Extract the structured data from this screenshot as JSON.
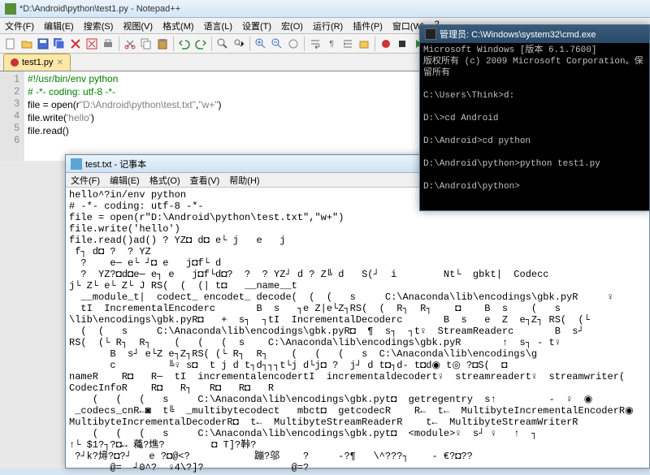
{
  "npp": {
    "title": "*D:\\Android\\python\\test1.py - Notepad++",
    "menu": [
      "文件(F)",
      "编辑(E)",
      "搜索(S)",
      "视图(V)",
      "格式(M)",
      "语言(L)",
      "设置(T)",
      "宏(O)",
      "运行(R)",
      "插件(P)",
      "窗口(W)",
      "?"
    ],
    "tab": "test1.py",
    "lines": [
      "1",
      "2",
      "3",
      "4",
      "5",
      "6"
    ],
    "code": {
      "l1": "#!/usr/bin/env python",
      "l2": "# -*- coding: utf-8 -*-",
      "l3a": "file = ",
      "l3b": "open",
      "l3c": "(r",
      "l3d": "\"D:\\Android\\python\\test.txt\"",
      "l3e": ",",
      "l3f": "\"w+\"",
      "l3g": ")",
      "l4a": "file.write(",
      "l4b": "'hello'",
      "l4c": ")",
      "l5": "file.read()"
    }
  },
  "notepad": {
    "title": "test.txt - 记事本",
    "menu": [
      "文件(F)",
      "编辑(E)",
      "格式(O)",
      "查看(V)",
      "帮助(H)"
    ],
    "body": "hello^?in/env python\n# -*- coding: utf-8 -*-\nfile = open(r\"D:\\Android\\python\\test.txt\",\"w+\")\nfile.write('hello')\nfile.read()ad() ? YZ◘ d◘ e└ j   e   j\n f┐ d◘ ?  ? YZ\n  ?    e─ e└ ┘◘ e   j◘f└ d\n  ?  YZ?◘d◘e─ e┐ e   j◘f└d◘?  ?  ? YZ┘ d ? Z╚ d   S(┘  i        Nt└  gbkt|  Codecc\nj└ Z└ e└ Z└ J RS(  (  (| t◘   __name__t\n  __module_t|  codect_ encodet_ decode(  (  (   s     C:\\Anaconda\\lib\\encodings\\gbk.pyR     ♀\n  tI  IncrementalEncoderc       B  s   ┐e Z|e└Z┐RS(  (  R┐  R┐    ◘    B  s    (   s\n\\lib\\encodings\\gbk.pyR◘   +  s┐  ┐tI  IncrementalDecoderc       B  s   e  Z  e┐Z┐ RS(  (└\n  (  (   s     C:\\Anaconda\\lib\\encodings\\gbk.pyR◘  ¶  s┐  ┐t♀  StreamReaderc       B  s┘\nRS(  (└ R┐  R┐    (   (   (  s    C:\\Anaconda\\lib\\encodings\\gbk.pyR       ↑  s┐ - t♀\n       B  s┘ e└Z e┐Z┐RS( (└ R┐  R┐    (   (   (   s  C:\\Anaconda\\lib\\encodings\\g\n       c         ╚♀ s◘  t j d t┐d┐┐┐t└j d└j◘ ?  j┘ d t◘┐d- t◘d◉ t◎ ?◘S(  ◘\nnameR    R◘   R─  tI  incrementalencodertI  incrementaldecodert♀  streamreadert♀  streamwriter(\nCodecInfoR    R◘   R┐   R◘   R◘   R\n    (   (   (   s     C:\\Anaconda\\lib\\encodings\\gbk.pyt◘  getregentry  s↑         -  ♀  ◉\n _codecs_cnR←◙  t╚  _multibytecodect   mbct◘  getcodecR    R←  t←  MultibyteIncrementalEncoderR◉\nMultibyteIncrementalDecoderR◘  t←  MultibyteStreamReaderR    t←  MultibyteStreamWriterR\n    (   (   (   s     C:\\Anaconda\\lib\\encodings\\gbk.pyt◘  <module>♀  s┘ ♀   ↑  ┐\n↑└ $1?┐?◘↔ 蘒?燋?        ◘ T]?鞐?\n ?┘k?燖?◘?┘   e ?◘@<?           蹦?邬    ?     -?¶   \\^???┐    - €?◘??\n       @=  ┘0^?  ♀4\\?]?               @=?"
  },
  "cmd": {
    "title": "管理员: C:\\Windows\\system32\\cmd.exe",
    "body": "Microsoft Windows [版本 6.1.7600]\n版权所有 (c) 2009 Microsoft Corporation。保留所有\n\nC:\\Users\\Think>d:\n\nD:\\>cd Android\n\nD:\\Android>cd python\n\nD:\\Android\\python>python test1.py\n\nD:\\Android\\python>"
  }
}
